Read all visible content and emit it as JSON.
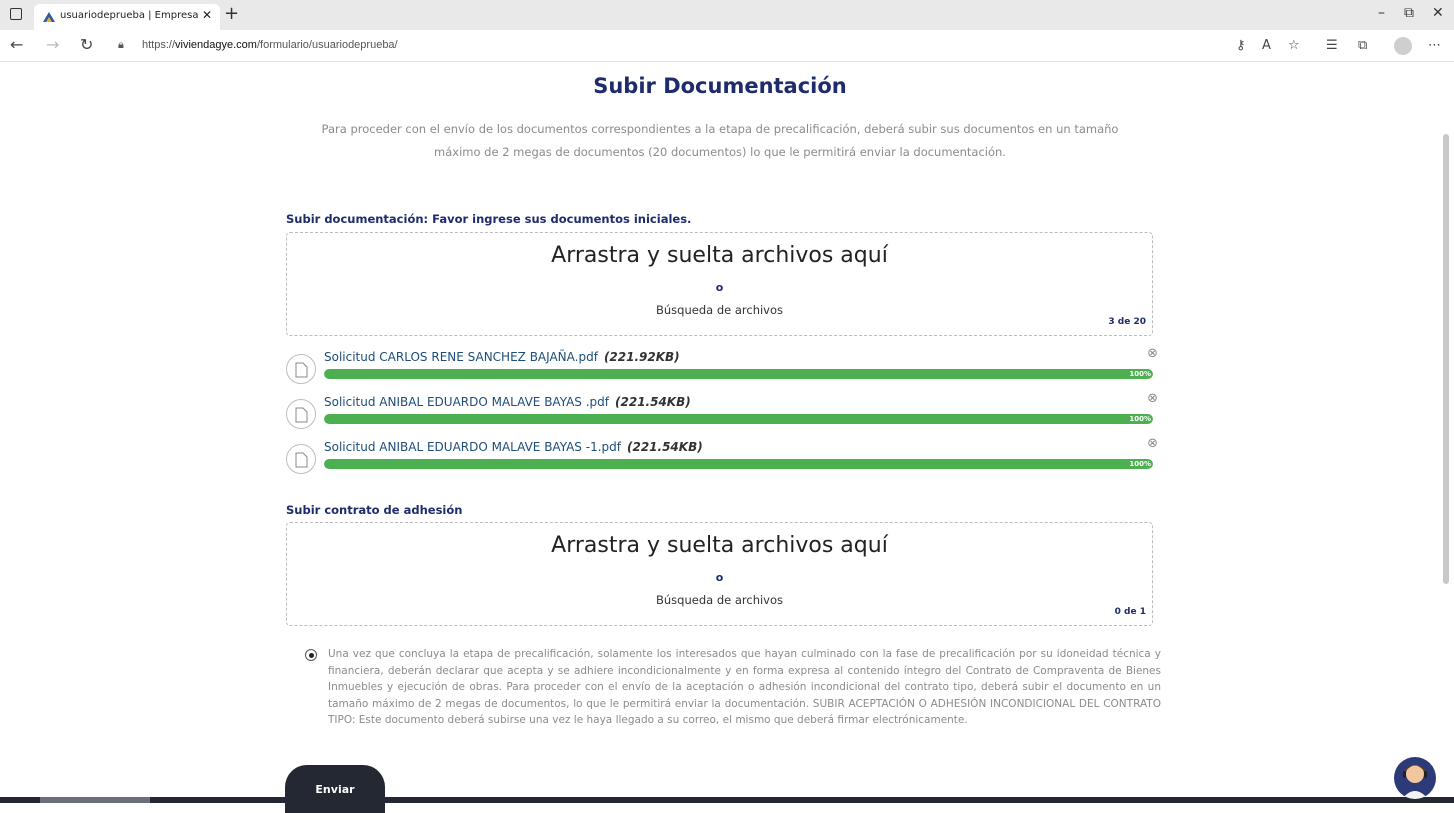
{
  "browser": {
    "tab_title": "usuariodeprueba | Empresa Públ",
    "new_tab_icon": "plus-icon",
    "url_prefix": "https://",
    "url_domain": "viviendagye.com",
    "url_path": "/formulario/usuariodeprueba/",
    "window_controls": {
      "minimize": "–",
      "restore": "⧉",
      "close": "✕"
    }
  },
  "page": {
    "title": "Subir Documentación",
    "intro_line1": "Para proceder con el envío de los documentos correspondientes a la etapa de precalificación, deberá subir sus documentos en un tamaño",
    "intro_line2": "máximo de 2 megas de documentos (20 documentos) lo que le permitirá enviar la documentación.",
    "section1": {
      "label": "Subir documentación: Favor ingrese sus documentos iniciales.",
      "dropzone_title": "Arrastra y suelta archivos aquí",
      "dropzone_or": "o",
      "dropzone_browse": "Búsqueda de archivos",
      "count": "3 de 20",
      "files": [
        {
          "name": "Solicitud CARLOS RENE SANCHEZ BAJAÑA.pdf",
          "size": "(221.92KB)",
          "progress": 100,
          "progress_label": "100%"
        },
        {
          "name": "Solicitud ANIBAL EDUARDO MALAVE BAYAS .pdf",
          "size": "(221.54KB)",
          "progress": 100,
          "progress_label": "100%"
        },
        {
          "name": "Solicitud ANIBAL EDUARDO MALAVE BAYAS -1.pdf",
          "size": "(221.54KB)",
          "progress": 100,
          "progress_label": "100%"
        }
      ]
    },
    "section2": {
      "label": "Subir contrato de adhesión",
      "dropzone_title": "Arrastra y suelta archivos aquí",
      "dropzone_or": "o",
      "dropzone_browse": "Búsqueda de archivos",
      "count": "0 de 1"
    },
    "terms": "Una vez que concluya la etapa de precalificación, solamente los interesados que hayan culminado con la fase de precalificación por su idoneidad técnica y financiera, deberán declarar que acepta y se adhiere incondicionalmente y en forma expresa al contenido íntegro del Contrato de Compraventa de Bienes Inmuebles y ejecución de obras. Para proceder con el envío de la aceptación o adhesión incondicional del contrato tipo, deberá subir el documento en un tamaño máximo de 2 megas de documentos, lo que le permitirá enviar la documentación. SUBIR ACEPTACIÓN O ADHESIÓN INCONDICIONAL DEL CONTRATO TIPO: Este documento deberá subirse una vez le haya llegado a su correo, el mismo que deberá firmar electrónicamente.",
    "submit_label": "Enviar"
  },
  "colors": {
    "heading": "#1e2c6b",
    "progress": "#4caf50",
    "footer": "#242833"
  }
}
